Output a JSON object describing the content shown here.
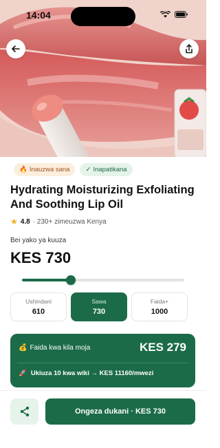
{
  "status_bar": {
    "time": "14:04"
  },
  "hero": {
    "image_alt": "Lip oil product close-up"
  },
  "badges": [
    {
      "icon": "flame-icon",
      "label": "Inauzwa sana"
    },
    {
      "icon": "check-icon",
      "label": "Inapatikana"
    }
  ],
  "product": {
    "title": "Hydrating Moisturizing Exfoliating And Soothing Lip Oil",
    "rating": "4.8",
    "sold_text": "· 230+ zimeuzwa Kenya"
  },
  "pricing": {
    "label": "Bei yako ya kuuza",
    "price": "KES 730",
    "slider_fraction": 0.3
  },
  "options": [
    {
      "label": "Ushindani",
      "value": "610",
      "active": false
    },
    {
      "label": "Sawa",
      "value": "730",
      "active": true
    },
    {
      "label": "Faida+",
      "value": "1000",
      "active": false
    }
  ],
  "profit": {
    "label": "Faida kwa kila moja",
    "value": "KES 279",
    "note": "Ukiuza 10 kwa wiki → KES 11160/mwezi"
  },
  "bottom": {
    "cta_label": "Ongeza dukani · KES 730"
  },
  "colors": {
    "accent": "#1b6b48",
    "accent_light": "#e5f3ea",
    "hot_badge_bg": "#fbeedd",
    "hot_badge_text": "#a0521a"
  }
}
